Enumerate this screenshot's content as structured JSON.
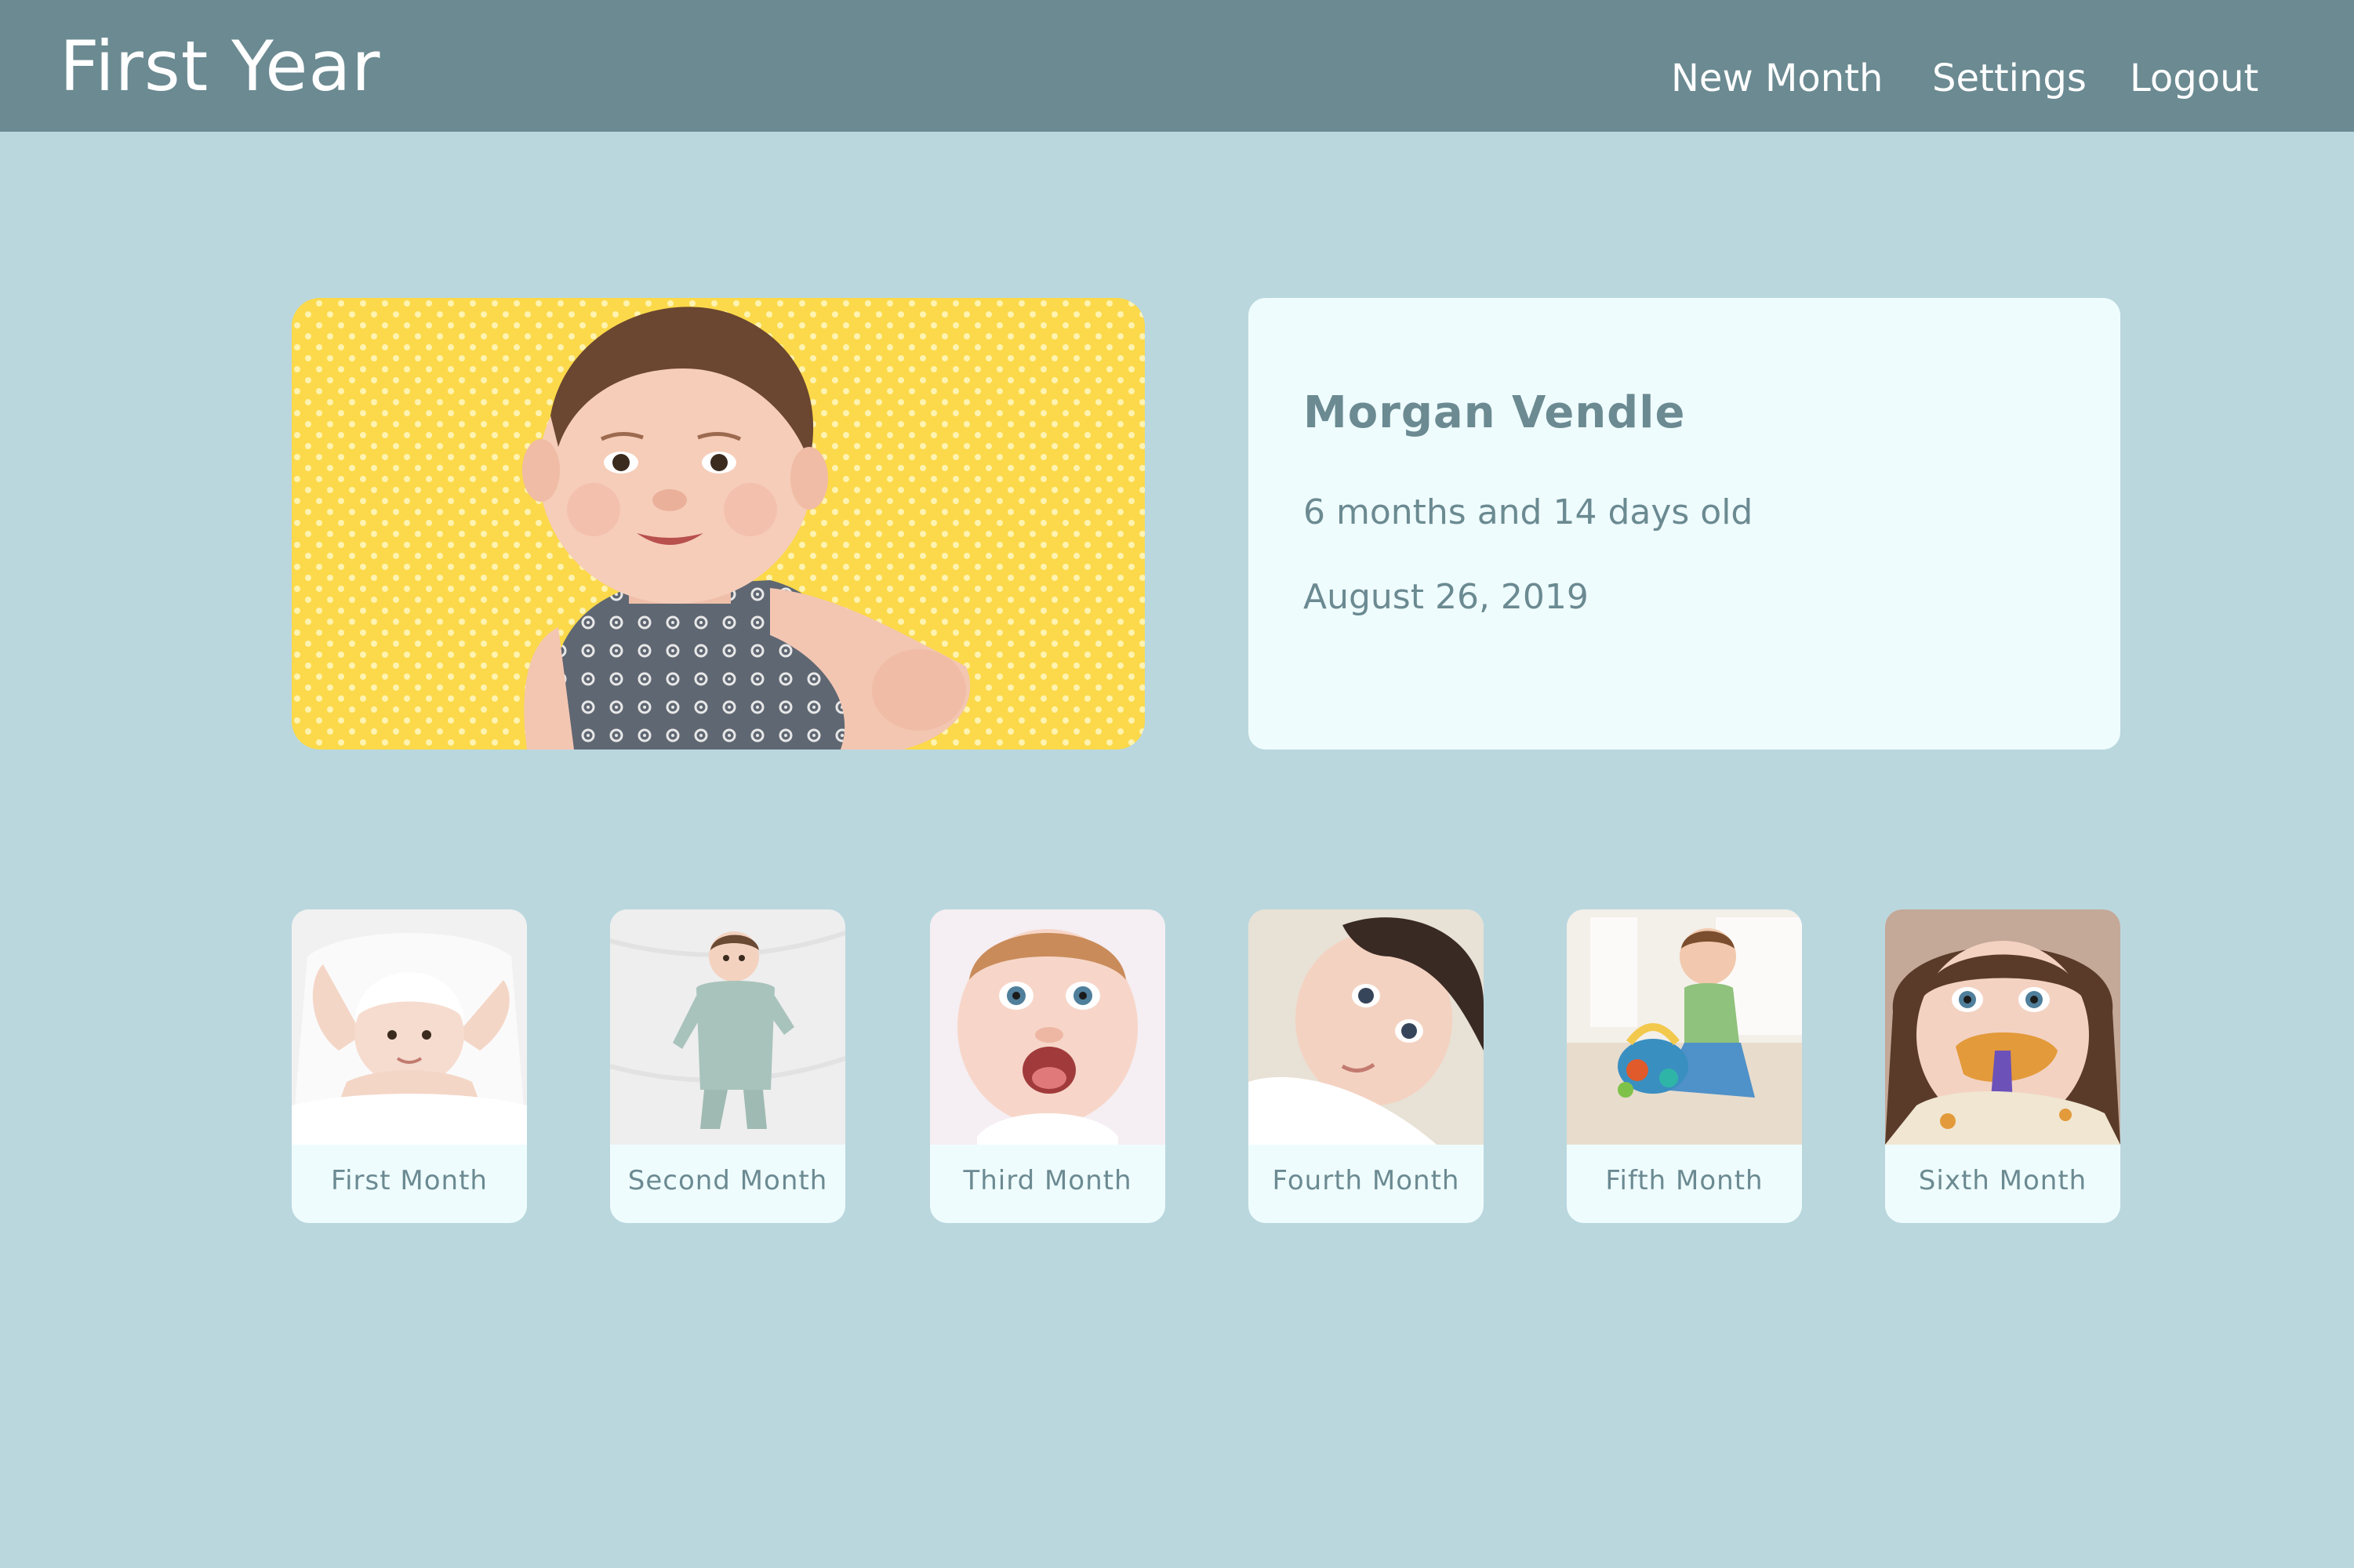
{
  "app": {
    "title": "First Year"
  },
  "nav": {
    "new_month": "New Month",
    "settings": "Settings",
    "logout": "Logout"
  },
  "profile": {
    "name": "Morgan Vendle",
    "age": "6 months and 14 days old",
    "date": "August 26, 2019"
  },
  "months": [
    {
      "label": "First Month"
    },
    {
      "label": "Second Month"
    },
    {
      "label": "Third Month"
    },
    {
      "label": "Fourth Month"
    },
    {
      "label": "Fifth Month"
    },
    {
      "label": "Sixth Month"
    }
  ],
  "colors": {
    "background": "#bad7de",
    "navbar": "#6b8a92",
    "card": "#effcfd",
    "text": "#6b8a92"
  }
}
